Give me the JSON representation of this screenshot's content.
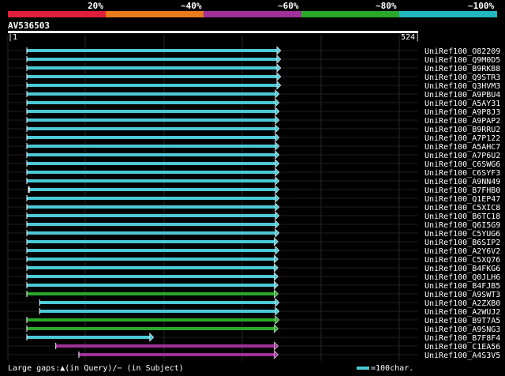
{
  "legend": {
    "labels": [
      "20%",
      "~40%",
      "~60%",
      "~80%",
      "~100%"
    ],
    "colors": [
      "#e0203a",
      "#e87a1a",
      "#a0309a",
      "#2aa82a",
      "#22b8c0"
    ]
  },
  "query": {
    "id": "AV536503",
    "start": "1",
    "end": "524"
  },
  "footer": {
    "gaps": "Large gaps:▲(in Query)/− (in Subject)",
    "scale": "=100char."
  },
  "hits": [
    {
      "name": "UniRef100_O82209",
      "start": 1,
      "end": 467,
      "color": "#4cc9d6"
    },
    {
      "name": "UniRef100_Q9M0D5",
      "start": 1,
      "end": 467,
      "color": "#4cc9d6"
    },
    {
      "name": "UniRef100_B9RKB8",
      "start": 1,
      "end": 467,
      "color": "#4cc9d6"
    },
    {
      "name": "UniRef100_Q9STR3",
      "start": 1,
      "end": 467,
      "color": "#4cc9d6"
    },
    {
      "name": "UniRef100_Q3HVM3",
      "start": 1,
      "end": 467,
      "color": "#4cc9d6"
    },
    {
      "name": "UniRef100_A9PBU4",
      "start": 1,
      "end": 464,
      "color": "#4cc9d6"
    },
    {
      "name": "UniRef100_A5AY31",
      "start": 1,
      "end": 464,
      "color": "#4cc9d6"
    },
    {
      "name": "UniRef100_A9P8J3",
      "start": 1,
      "end": 464,
      "color": "#4cc9d6"
    },
    {
      "name": "UniRef100_A9PAP2",
      "start": 1,
      "end": 464,
      "color": "#4cc9d6"
    },
    {
      "name": "UniRef100_B9RRU2",
      "start": 1,
      "end": 464,
      "color": "#4cc9d6"
    },
    {
      "name": "UniRef100_A7P122",
      "start": 1,
      "end": 464,
      "color": "#4cc9d6"
    },
    {
      "name": "UniRef100_A5AHC7",
      "start": 1,
      "end": 464,
      "color": "#4cc9d6"
    },
    {
      "name": "UniRef100_A7P6U2",
      "start": 1,
      "end": 464,
      "color": "#4cc9d6"
    },
    {
      "name": "UniRef100_C6SWG6",
      "start": 1,
      "end": 464,
      "color": "#4cc9d6"
    },
    {
      "name": "UniRef100_C6SYF3",
      "start": 1,
      "end": 464,
      "color": "#4cc9d6"
    },
    {
      "name": "UniRef100_A9NN49",
      "start": 1,
      "end": 464,
      "color": "#4cc9d6"
    },
    {
      "name": "UniRef100_B7FHB0",
      "start": 4,
      "end": 464,
      "color": "#4cc9d6",
      "mark": true
    },
    {
      "name": "UniRef100_Q1EP47",
      "start": 1,
      "end": 464,
      "color": "#4cc9d6"
    },
    {
      "name": "UniRef100_C5XIC8",
      "start": 1,
      "end": 464,
      "color": "#4cc9d6"
    },
    {
      "name": "UniRef100_B6TC18",
      "start": 1,
      "end": 464,
      "color": "#4cc9d6"
    },
    {
      "name": "UniRef100_Q6I5G9",
      "start": 1,
      "end": 464,
      "color": "#4cc9d6"
    },
    {
      "name": "UniRef100_C5YUG6",
      "start": 1,
      "end": 464,
      "color": "#4cc9d6"
    },
    {
      "name": "UniRef100_B6SIP2",
      "start": 1,
      "end": 462,
      "color": "#4cc9d6"
    },
    {
      "name": "UniRef100_A2Y6V2",
      "start": 1,
      "end": 464,
      "color": "#4cc9d6"
    },
    {
      "name": "UniRef100_C5XQ76",
      "start": 1,
      "end": 462,
      "color": "#4cc9d6"
    },
    {
      "name": "UniRef100_B4FKG6",
      "start": 1,
      "end": 462,
      "color": "#4cc9d6"
    },
    {
      "name": "UniRef100_Q0JLH6",
      "start": 1,
      "end": 462,
      "color": "#4cc9d6"
    },
    {
      "name": "UniRef100_B4FJB5",
      "start": 1,
      "end": 462,
      "color": "#4cc9d6"
    },
    {
      "name": "UniRef100_A9SWT3",
      "start": 1,
      "end": 462,
      "color": "#2aa82a"
    },
    {
      "name": "UniRef100_A2ZXB0",
      "start": 25,
      "end": 464,
      "color": "#4cc9d6"
    },
    {
      "name": "UniRef100_A2WUJ2",
      "start": 25,
      "end": 464,
      "color": "#4cc9d6"
    },
    {
      "name": "UniRef100_B9T7A5",
      "start": 1,
      "end": 464,
      "color": "#2aa82a"
    },
    {
      "name": "UniRef100_A9SNG3",
      "start": 1,
      "end": 462,
      "color": "#2aa82a"
    },
    {
      "name": "UniRef100_B7F8F4",
      "start": 1,
      "end": 230,
      "color": "#4cc9d6"
    },
    {
      "name": "UniRef100_C1EA56",
      "start": 55,
      "end": 462,
      "color": "#a0309a"
    },
    {
      "name": "UniRef100_A4S3V5",
      "start": 98,
      "end": 462,
      "color": "#a0309a"
    }
  ]
}
